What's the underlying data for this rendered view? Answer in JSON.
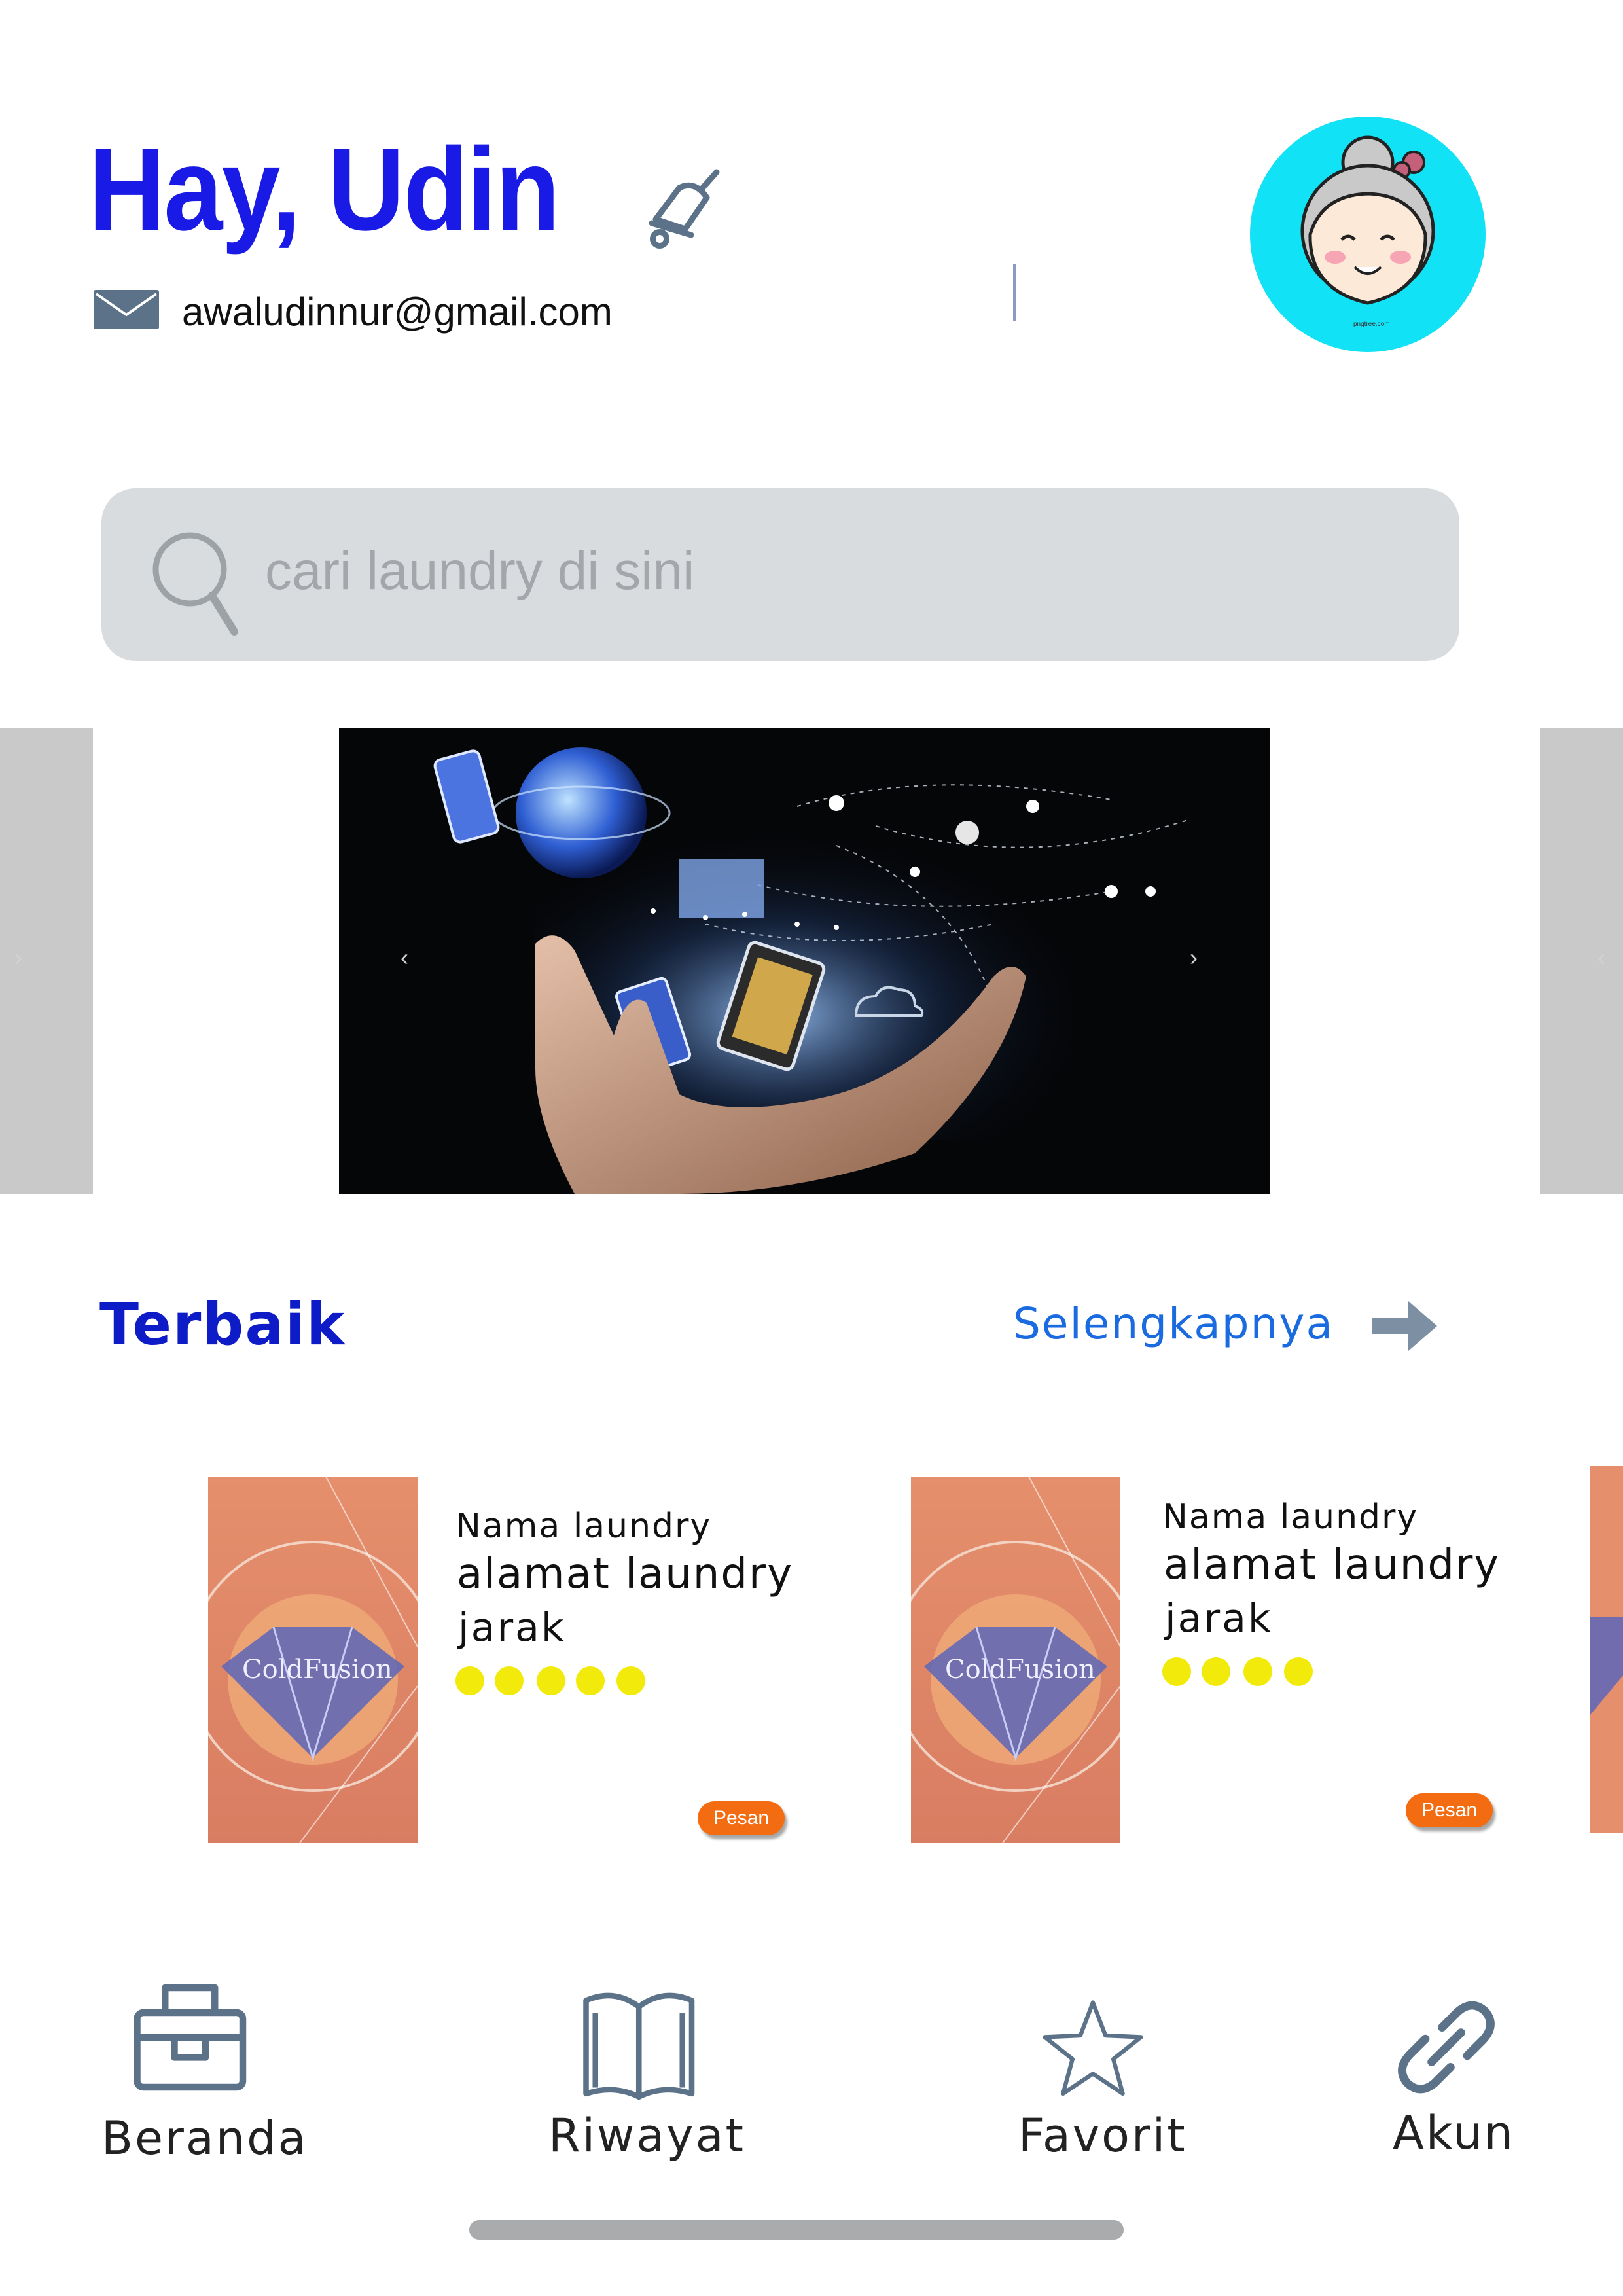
{
  "header": {
    "greeting": "Hay, Udin",
    "email": "awaludinnur@gmail.com",
    "bell_icon": "bell-icon",
    "mail_icon": "mail-icon",
    "avatar_bg": "#12e2f6",
    "avatar_caption": "pngtree.com"
  },
  "search": {
    "placeholder": "cari laundry di sini",
    "icon": "search-icon"
  },
  "carousel": {
    "prev_glyph": "‹",
    "next_glyph": "›"
  },
  "section": {
    "title": "Terbaik",
    "see_more": "Selengkapnya",
    "see_more_icon": "arrow-right-icon"
  },
  "cards": [
    {
      "image_caption": "ColdFusion",
      "name": "Nama laundry",
      "address": "alamat laundry",
      "distance": "jarak",
      "rating": 5,
      "button": "Pesan"
    },
    {
      "image_caption": "ColdFusion",
      "name": "Nama laundry",
      "address": "alamat laundry",
      "distance": "jarak",
      "rating": 4,
      "button": "Pesan"
    }
  ],
  "nav": [
    {
      "label": "Beranda",
      "icon": "home-briefcase-icon"
    },
    {
      "label": "Riwayat",
      "icon": "book-icon"
    },
    {
      "label": "Favorit",
      "icon": "star-icon"
    },
    {
      "label": "Akun",
      "icon": "link-icon"
    }
  ],
  "colors": {
    "accent_blue": "#1a1ae6",
    "section_blue": "#0d1cc7",
    "link_blue": "#1a6ae0",
    "search_bg": "#d9dcde",
    "rating_yellow": "#f1ea0a",
    "button_orange": "#f36c12",
    "icon_slate": "#5b7289"
  }
}
